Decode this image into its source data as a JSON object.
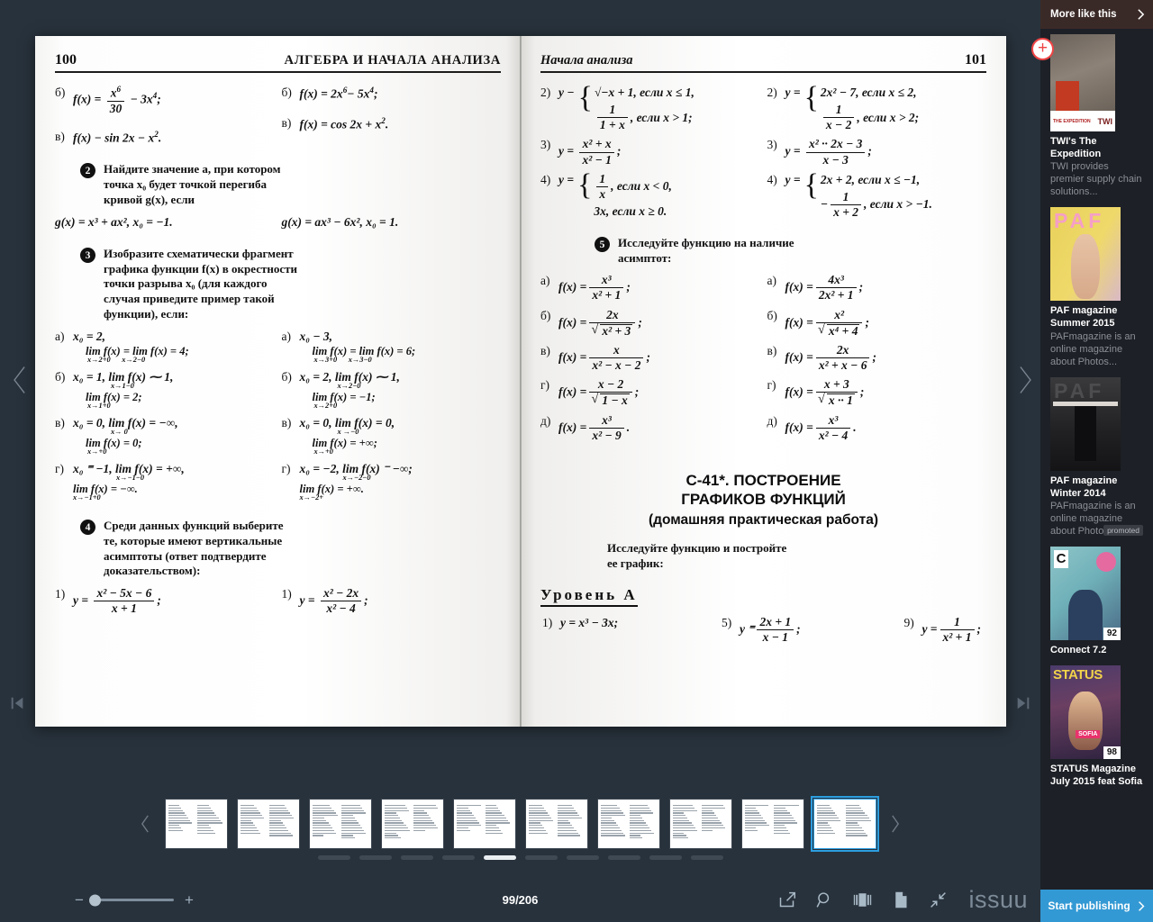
{
  "reader": {
    "page_indicator": "99/206",
    "zoom_minus": "−",
    "zoom_plus": "+",
    "brand": "issuu",
    "tools": [
      {
        "name": "share-icon",
        "label": "Share"
      },
      {
        "name": "search-icon",
        "label": "Search"
      },
      {
        "name": "page-view-icon",
        "label": "Page view"
      },
      {
        "name": "single-page-icon",
        "label": "Single page"
      },
      {
        "name": "exit-fullscreen-icon",
        "label": "Exit fullscreen"
      }
    ],
    "nav": {
      "prev": "Previous page",
      "next": "Next page",
      "first": "First page",
      "last": "Last page",
      "thumb_prev": "Previous thumbnails",
      "thumb_next": "Next thumbnails"
    },
    "thumbnails": {
      "count": 10,
      "active_index": 9
    },
    "dots": {
      "count": 10,
      "active_index": 4
    }
  },
  "left_page": {
    "number": "100",
    "title": "АЛГЕБРА И НАЧАЛА АНАЛИЗА",
    "top_rows": {
      "l_b": {
        "label": "б)",
        "expr_pre": "f(x) =",
        "num": "x",
        "num_sup": "6",
        "den": "30",
        "tail": "− 3x",
        "tail_sup": "4",
        "end": ";"
      },
      "r_b": {
        "label": "б)",
        "expr": "f(x) = 2x",
        "sup1": "6",
        "mid": "− 5x",
        "sup2": "4",
        "end": ";"
      },
      "l_v": {
        "label": "в)",
        "expr": "f(x) − sin 2x − x",
        "sup": "2",
        "end": "."
      },
      "r_v": {
        "label": "в)",
        "expr": "f(x) = cos 2x + x",
        "sup": "2",
        "end": "."
      }
    },
    "task2": {
      "number": "2",
      "text_line1": "Найдите значение a, при котором",
      "text_line2": "точка x₀ будет точкой перегиба",
      "text_line3": "кривой g(x), если",
      "left_formula": "g(x) = x³ + ax², x₀ = −1.",
      "right_formula": "g(x) = ax³ − 6x², x₀ = 1."
    },
    "task3": {
      "number": "3",
      "text_line1": "Изобразите схематически фрагмент",
      "text_line2": "графика функции f(x)  в окрестности",
      "text_line3": "точки разрыва x₀ (для каждого",
      "text_line4": "случая приведите пример такой",
      "text_line5": "функции), если:",
      "left_items": [
        {
          "label": "а)",
          "line1": "x₀ = 2,",
          "line2": "lim f(x) = lim f(x) = 4;",
          "sub1": "x→2+0",
          "sub2": "x→2−0"
        },
        {
          "label": "б)",
          "line1": "x₀ = 1, lim f(x) ⁓ 1,",
          "line2": "lim f(x) = 2;",
          "sub1": "x→1−0",
          "sub2": "x→1+0"
        },
        {
          "label": "в)",
          "line1": "x₀ = 0, lim f(x) = −∞,",
          "line2": "lim f(x) = 0;",
          "sub1": "x→ 0",
          "sub2": "x→+0"
        },
        {
          "label": "г)",
          "line1": "x₀ ⁼ −1, lim f(x) = +∞,",
          "line2": "lim f(x) = −∞.",
          "sub1": "x→−1−0",
          "sub2": "x→−1+0"
        }
      ],
      "right_items": [
        {
          "label": "а)",
          "line1": "x₀ − 3,",
          "line2": "lim f(x) = lim f(x) = 6;",
          "sub1": "x→3+0",
          "sub2": "x→3−0"
        },
        {
          "label": "б)",
          "line1": "x₀ = 2, lim f(x) ⁓ 1,",
          "line2": "lim f(x) = −1;",
          "sub1": "x→2−0",
          "sub2": "x→2+0"
        },
        {
          "label": "в)",
          "line1": "x₀ = 0, lim f(x) = 0,",
          "line2": "lim f(x) = +∞;",
          "sub1": "x →−0",
          "sub2": "x→+0"
        },
        {
          "label": "г)",
          "line1": "x₀ = −2, lim f(x) ⁻ −∞;",
          "line2": "lim f(x) = +∞.",
          "sub1": "x→−2−0",
          "sub2": "x→−2+"
        }
      ]
    },
    "task4": {
      "number": "4",
      "text_line1": "Среди данных функций выберите",
      "text_line2": "те, которые имеют вертикальные",
      "text_line3": "асимптоты (ответ подтвердите",
      "text_line4": "доказательством):",
      "left_item": {
        "label": "1)",
        "lhs": "y =",
        "num": "x² − 5x − 6",
        "den": "x + 1",
        "end": ";"
      },
      "right_item": {
        "label": "1)",
        "lhs": "y =",
        "num": "x² − 2x",
        "den": "x² − 4",
        "end": ";"
      }
    }
  },
  "right_page": {
    "number": "101",
    "title": "Начала анализа",
    "left_items": [
      {
        "label": "2)",
        "lhs": "y −",
        "case1": "√−x + 1, если x ≤ 1,",
        "case2_num": "1",
        "case2_den": "1 + x",
        "case2_tail": ", если x > 1;"
      },
      {
        "label": "3)",
        "lhs": "y =",
        "num": "x² + x",
        "den": "x² − 1",
        "end": ";"
      },
      {
        "label": "4)",
        "lhs": "y =",
        "case1_num": "1",
        "case1_den": "x",
        "case1_tail": ", если x < 0,",
        "case2": "3x, если x ≥ 0."
      }
    ],
    "right_items": [
      {
        "label": "2)",
        "lhs": "y =",
        "case1": "2x² − 7, если x ≤ 2,",
        "case2_num": "1",
        "case2_den": "x − 2",
        "case2_tail": ", если x > 2;"
      },
      {
        "label": "3)",
        "lhs": "y =",
        "num": "x² ·· 2x − 3",
        "den": "x − 3",
        "end": ";"
      },
      {
        "label": "4)",
        "lhs": "y =",
        "case1": "2x + 2, если x ≤  −1,",
        "case2_num": "1",
        "case2_den": "x + 2",
        "case2_pre": "−",
        "case2_tail": ", если x > −1."
      }
    ],
    "task5": {
      "number": "5",
      "text_line1": "Исследуйте функцию на наличие",
      "text_line2": "асимптот:",
      "left_items": [
        {
          "label": "а)",
          "lhs": "f(x) =",
          "num": "x³",
          "den": "x² + 1",
          "end": ";",
          "root": false
        },
        {
          "label": "б)",
          "lhs": "f(x) =",
          "num": "2x",
          "den": "x² + 3",
          "end": ";",
          "root": true
        },
        {
          "label": "в)",
          "lhs": "f(x) =",
          "num": "x",
          "den": "x² − x − 2",
          "end": ";",
          "root": false
        },
        {
          "label": "г)",
          "lhs": "f(x) =",
          "num": "x − 2",
          "den": "1 − x",
          "end": ";",
          "root": true
        },
        {
          "label": "д)",
          "lhs": "f(x) =",
          "num": "x³",
          "den": "x² − 9",
          "end": ".",
          "root": false
        }
      ],
      "right_items": [
        {
          "label": "а)",
          "lhs": "f(x) =",
          "num": "4x³",
          "den": "2x² + 1",
          "end": ";",
          "root": false
        },
        {
          "label": "б)",
          "lhs": "f(x) =",
          "num": "x²",
          "den": "x⁴ + 4",
          "end": ";",
          "root": true
        },
        {
          "label": "в)",
          "lhs": "f(x) =",
          "num": "2x",
          "den": "x² + x − 6",
          "end": ";",
          "root": false
        },
        {
          "label": "г)",
          "lhs": "f(x) =",
          "num": "x + 3",
          "den": "x ·· 1",
          "end": ";",
          "root": true
        },
        {
          "label": "д)",
          "lhs": "f(x) =",
          "num": "x³",
          "den": "x² − 4",
          "end": ".",
          "root": false
        }
      ]
    },
    "section": {
      "title_line1": "С-41*. ПОСТРОЕНИЕ",
      "title_line2": "ГРАФИКОВ ФУНКЦИЙ",
      "subtitle": "(домашняя практическая работа)",
      "lead_line1": "Исследуйте функцию и постройте",
      "lead_line2": "ее график:",
      "level": "Уровень А",
      "items": [
        {
          "label": "1)",
          "expr": "y = x³ − 3x;",
          "frac": false
        },
        {
          "label": "5)",
          "lhs": "y ⁼",
          "num": "2x + 1",
          "den": "x − 1",
          "end": ";",
          "frac": true
        },
        {
          "label": "9)",
          "lhs": "y =",
          "num": "1",
          "den": "x² + 1",
          "end": ";",
          "frac": true
        }
      ]
    }
  },
  "sidebar": {
    "header": "More like this",
    "items": [
      {
        "title": "TWI's The Expedition",
        "desc": "TWI provides premier supply chain solutions...",
        "art": "expedition",
        "band_left": "THE EXPEDITION",
        "band_right": "TWI",
        "promoted": "",
        "pages": ""
      },
      {
        "title": "PAF magazine Summer 2015",
        "desc": "PAFmagazine is an online magazine about Photos...",
        "art": "paf1",
        "promoted": "",
        "pages": ""
      },
      {
        "title": "PAF magazine Winter 2014",
        "desc": "PAFmagazine is an online magazine about Photos...",
        "art": "paf2",
        "promoted": "promoted",
        "pages": ""
      },
      {
        "title": "Connect 7.2",
        "desc": "",
        "art": "connect",
        "promoted": "",
        "pages": "92"
      },
      {
        "title": "STATUS Magazine July 2015 feat Sofia",
        "desc": "",
        "art": "status",
        "promoted": "",
        "pages": "98"
      }
    ],
    "add_badge": "+",
    "publish_label": "Start publishing"
  },
  "colors": {
    "app_bg": "#28323c",
    "sidebar_bg": "#1d2026",
    "sidebar_header_bg": "#3a2a27",
    "accent_blue": "#3399d4",
    "active_thumb": "#2c9ee0",
    "badge_red": "#ef4444"
  }
}
